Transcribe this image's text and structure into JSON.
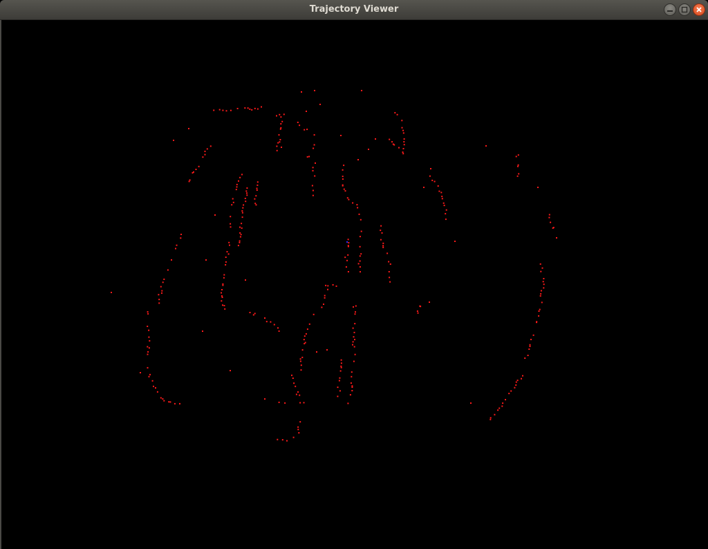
{
  "window": {
    "title": "Trajectory Viewer"
  },
  "controls": {
    "minimize_icon": "minimize-icon",
    "maximize_icon": "maximize-icon",
    "close_icon": "close-icon"
  },
  "colors": {
    "point": "#ff1a1a",
    "background": "#000000",
    "marker": "#2a2aff"
  }
}
